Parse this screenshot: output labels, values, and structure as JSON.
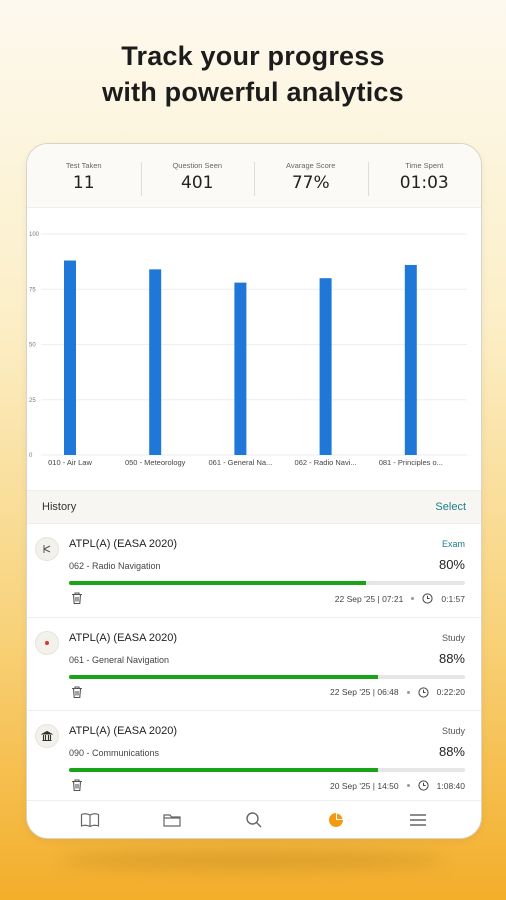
{
  "headline": {
    "line1": "Track your progress",
    "line2": "with powerful analytics"
  },
  "stats": [
    {
      "label": "Test Taken",
      "value": "11"
    },
    {
      "label": "Question Seen",
      "value": "401"
    },
    {
      "label": "Avarage Score",
      "value": "77%"
    },
    {
      "label": "Time Spent",
      "value": "01:03"
    }
  ],
  "chart_data": {
    "type": "bar",
    "categories": [
      "010 - Air Law",
      "050 - Meteorology",
      "061 - General Na...",
      "062 - Radio Navi...",
      "081 - Principles o..."
    ],
    "values": [
      88,
      84,
      78,
      80,
      86
    ],
    "yticks": [
      "0",
      "25",
      "50",
      "75",
      "100"
    ],
    "ylim": [
      0,
      100
    ],
    "bar_color": "#1f78d8",
    "title": "",
    "xlabel": "",
    "ylabel": ""
  },
  "history": {
    "title": "History",
    "select_label": "Select",
    "items": [
      {
        "icon": "radio-tower-icon",
        "title": "ATPL(A) (EASA 2020)",
        "mode": "Exam",
        "subject": "062 - Radio Navigation",
        "score": "80%",
        "progress": 0.75,
        "date": "22 Sep '25 | 07:21",
        "duration": "0:1:57"
      },
      {
        "icon": "compass-pin-icon",
        "title": "ATPL(A) (EASA 2020)",
        "mode": "Study",
        "subject": "061 - General Navigation",
        "score": "88%",
        "progress": 0.78,
        "date": "22 Sep '25 | 06:48",
        "duration": "0:22:20"
      },
      {
        "icon": "building-icon",
        "title": "ATPL(A) (EASA 2020)",
        "mode": "Study",
        "subject": "090 - Communications",
        "score": "88%",
        "progress": 0.78,
        "date": "20 Sep '25 | 14:50",
        "duration": "1:08:40"
      }
    ]
  },
  "tabs": [
    {
      "icon": "book-icon",
      "active": false
    },
    {
      "icon": "folder-icon",
      "active": false
    },
    {
      "icon": "search-icon",
      "active": false
    },
    {
      "icon": "pie-chart-icon",
      "active": true
    },
    {
      "icon": "menu-icon",
      "active": false
    }
  ],
  "colors": {
    "accent": "#f39a12",
    "progress": "#19a319",
    "link": "#1a7f8e"
  }
}
